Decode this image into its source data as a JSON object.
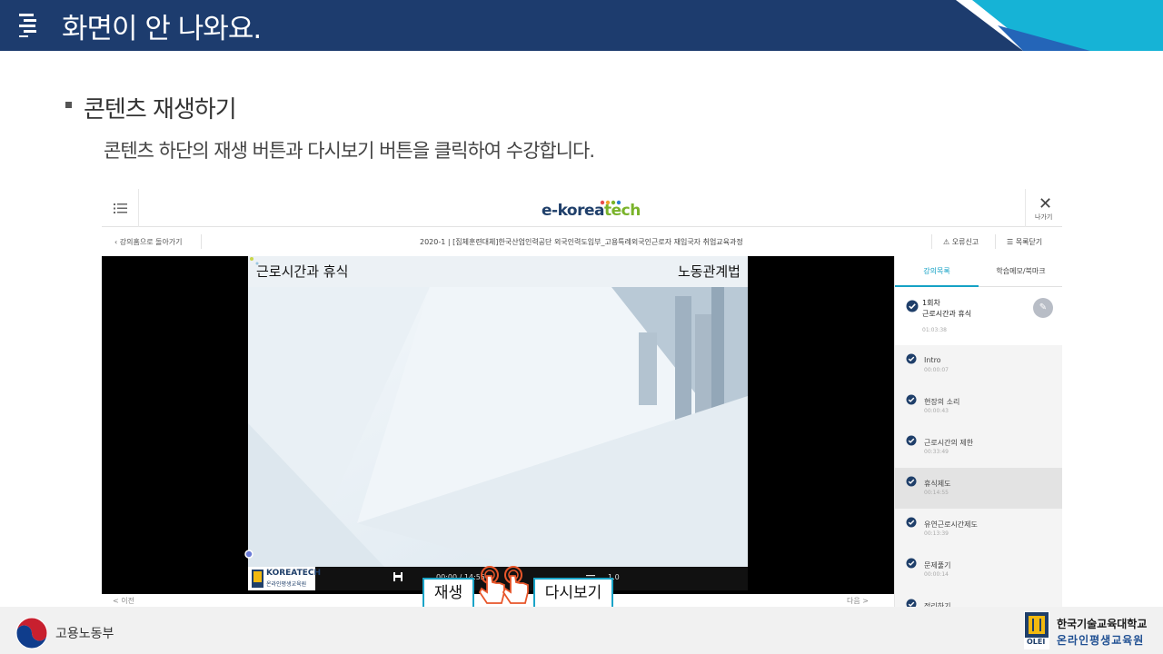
{
  "header": {
    "title": "화면이 안 나와요.",
    "icon": "list-lines-icon",
    "colors": {
      "background": "#1d3c6e",
      "accent_cyan": "#16b3d6",
      "accent_blue": "#2465b8"
    }
  },
  "section": {
    "title": "콘텐츠 재생하기",
    "description": "콘텐츠 하단의 재생 버튼과 다시보기 버튼을 클릭하여 수강합니다."
  },
  "player": {
    "logo": {
      "main": "e-korea",
      "accent": "tech"
    },
    "close_label": "나가기",
    "back_label": "강의홈으로 돌아가기",
    "course_title": "2020-1  |  [집체훈련대체]한국산업인력공단 외국인력도입부_고용특례외국인근로자 재입국자 취업교육과정",
    "report_label": "오류신고",
    "close_list_label": "목록닫기",
    "slide": {
      "title": "근로시간과 휴식",
      "subject": "노동관계법"
    },
    "controls": {
      "brand_main": "KOREATECH",
      "brand_sub": "온라인평생교육원",
      "time": "00:00 / 14:55",
      "speed": "1.0"
    },
    "bottom_nav": {
      "prev": "< 이전",
      "next": "다음 >"
    },
    "sidebar": {
      "tabs": [
        {
          "label": "강의목록",
          "active": true
        },
        {
          "label": "학습메모/북마크",
          "active": false
        }
      ],
      "chapter": {
        "title_line1": "1회차",
        "title_line2": "근로시간과 휴식",
        "duration": "01:03:38"
      },
      "lessons": [
        {
          "name": "Intro",
          "duration": "00:00:07"
        },
        {
          "name": "현장의 소리",
          "duration": "00:00:43"
        },
        {
          "name": "근로시간의 제한",
          "duration": "00:33:49"
        },
        {
          "name": "휴식제도",
          "duration": "00:14:55",
          "selected": true
        },
        {
          "name": "유연근로시간제도",
          "duration": "00:13:39"
        },
        {
          "name": "문제풀기",
          "duration": "00:00:14"
        },
        {
          "name": "정리하기",
          "duration": ""
        }
      ]
    },
    "accent_color": "#15a2c5"
  },
  "callouts": {
    "play": "재생",
    "replay": "다시보기",
    "border_color": "#1aa4c8"
  },
  "footer": {
    "ministry": "고용노동부",
    "university": "한국기술교육대학교",
    "institute": "온라인평생교육원",
    "olei": "OLEI"
  }
}
